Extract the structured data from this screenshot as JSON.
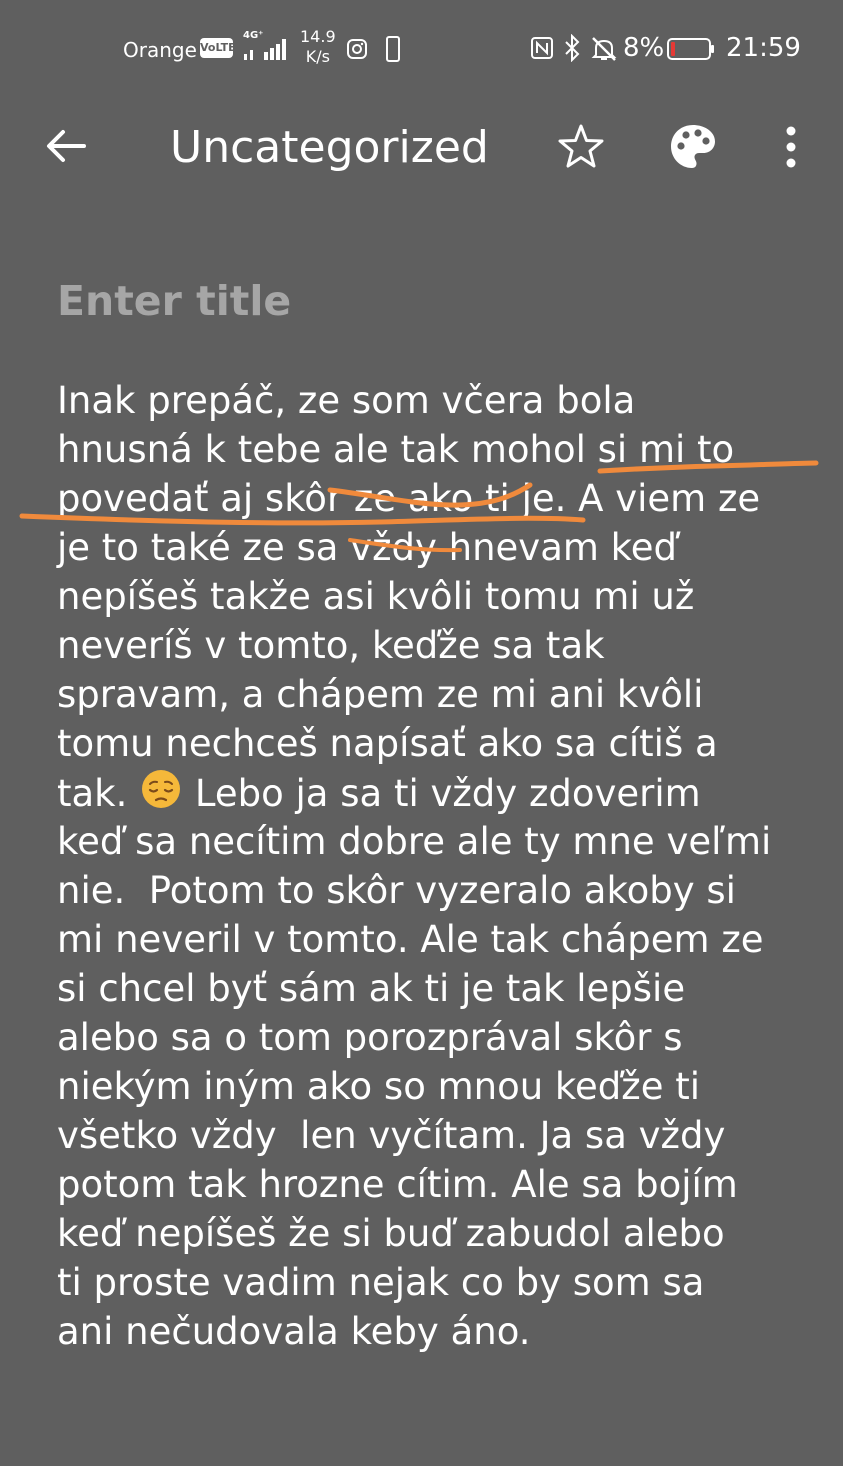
{
  "status_bar": {
    "carrier": "Orange",
    "volte": "VoLTE",
    "network": "4G⁺",
    "speed_value": "14.9",
    "speed_unit": "K/s",
    "battery_percent": "8%",
    "time": "21:59",
    "icons": [
      "signal-icon",
      "instagram-icon",
      "phone-icon",
      "nfc-icon",
      "bluetooth-icon",
      "mute-icon",
      "battery-icon"
    ]
  },
  "app_bar": {
    "title": "Uncategorized",
    "icons": [
      "back-arrow-icon",
      "star-icon",
      "palette-icon",
      "more-vert-icon"
    ]
  },
  "note": {
    "title_placeholder": "Enter title",
    "emoji": "😔",
    "lines": [
      "Inak prepáč, ze som včera bola",
      "hnusná k tebe ale tak mohol si mi to",
      "povedať aj skôr ze ako ti je. A viem ze",
      "je to také ze sa vždy hnevam keď",
      "nepíšeš takže asi kvôli tomu mi už",
      "neveríš v tomto, keďže sa tak",
      "spravam, a chápem ze mi ani kvôli",
      "tomu nechceš napísať ako sa cítiš a",
      "tak.",
      " Lebo ja sa ti vždy zdoverim",
      "keď sa necítim dobre ale ty mne veľmi",
      "nie.  Potom to skôr vyzeralo akoby si",
      "mi neveril v tomto. Ale tak chápem ze",
      "si chcel byť sám ak ti je tak lepšie",
      "alebo sa o tom porozprával skôr s",
      "niekým iným ako so mnou keďže ti",
      "všetko vždy  len vyčítam. Ja sa vždy",
      "potom tak hrozne cítim. Ale sa bojím",
      "keď nepíšeš že si buď zabudol alebo",
      "ti proste vadim nejak co by som sa",
      "ani nečudovala keby áno."
    ]
  },
  "colors": {
    "background": "#5f5f5f",
    "placeholder": "#a6a6a6",
    "annotation": "#f08a3c",
    "battery_low": "#e53935"
  }
}
